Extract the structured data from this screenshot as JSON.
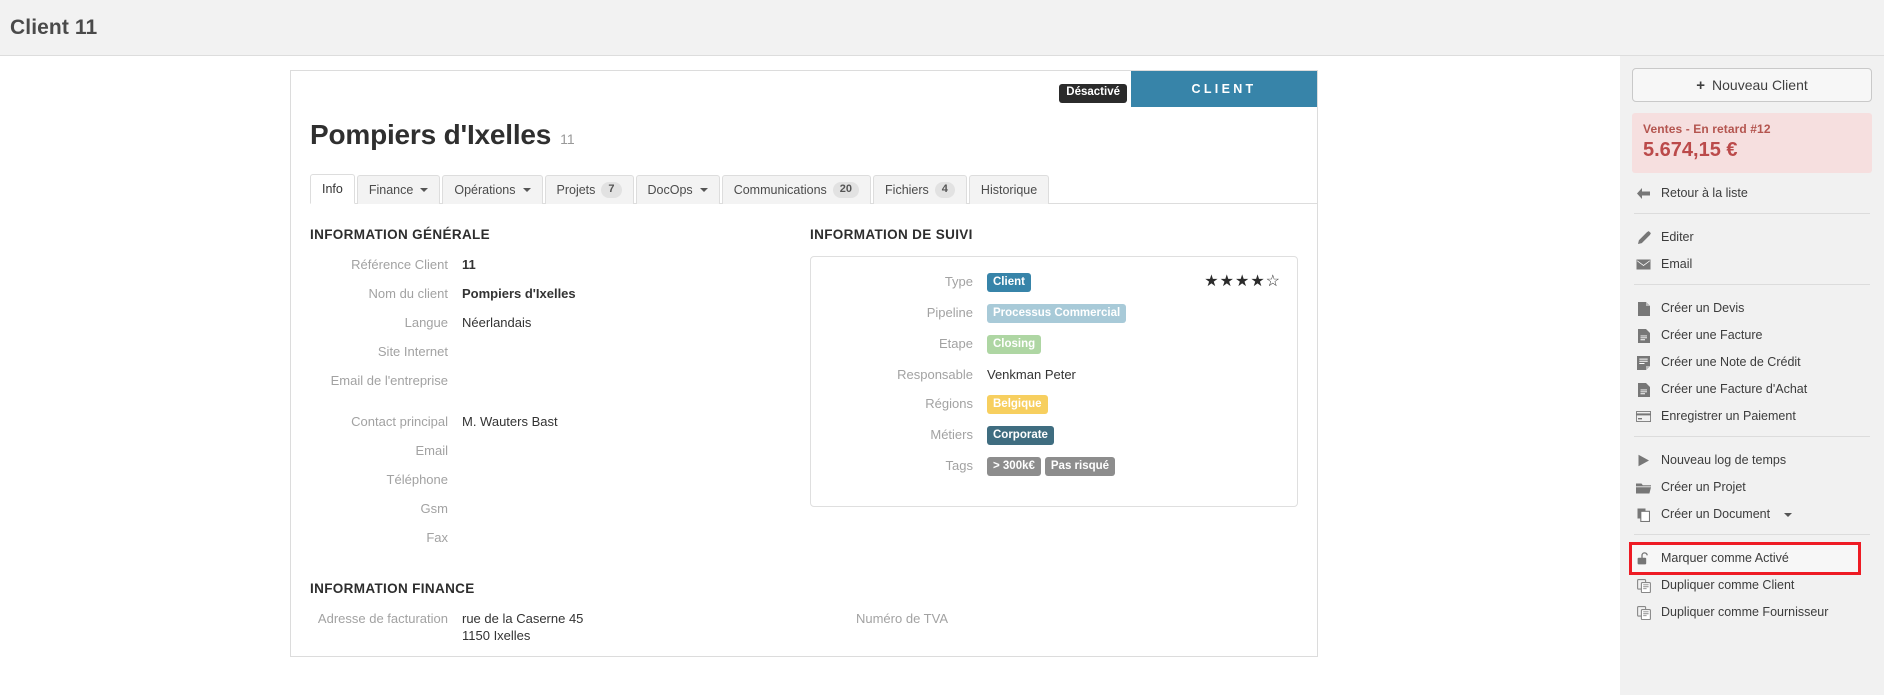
{
  "topbar": {
    "title": "Client 11"
  },
  "card": {
    "status_badge": "Désactivé",
    "type_banner": "CLIENT",
    "title": "Pompiers d'Ixelles",
    "title_sub": "11",
    "tabs": [
      {
        "label": "Info",
        "count": null,
        "caret": false,
        "active": true
      },
      {
        "label": "Finance",
        "count": null,
        "caret": true,
        "active": false
      },
      {
        "label": "Opérations",
        "count": null,
        "caret": true,
        "active": false
      },
      {
        "label": "Projets",
        "count": "7",
        "caret": false,
        "active": false
      },
      {
        "label": "DocOps",
        "count": null,
        "caret": true,
        "active": false
      },
      {
        "label": "Communications",
        "count": "20",
        "caret": false,
        "active": false
      },
      {
        "label": "Fichiers",
        "count": "4",
        "caret": false,
        "active": false
      },
      {
        "label": "Historique",
        "count": null,
        "caret": false,
        "active": false
      }
    ],
    "general": {
      "section_title": "INFORMATION GÉNÉRALE",
      "fields": [
        {
          "label": "Référence Client",
          "value": "11",
          "bold": true
        },
        {
          "label": "Nom du client",
          "value": "Pompiers d'Ixelles",
          "bold": true
        },
        {
          "label": "Langue",
          "value": "Néerlandais",
          "bold": false
        },
        {
          "label": "Site Internet",
          "value": "",
          "bold": false
        },
        {
          "label": "Email de l'entreprise",
          "value": "",
          "bold": false
        },
        {
          "label": "Contact principal",
          "value": "M. Wauters Bast",
          "bold": false
        },
        {
          "label": "Email",
          "value": "",
          "bold": false
        },
        {
          "label": "Téléphone",
          "value": "",
          "bold": false
        },
        {
          "label": "Gsm",
          "value": "",
          "bold": false
        },
        {
          "label": "Fax",
          "value": "",
          "bold": false
        }
      ]
    },
    "suivi": {
      "section_title": "INFORMATION DE SUIVI",
      "rating_filled": 4,
      "rating_total": 5,
      "fields": [
        {
          "label": "Type",
          "pills": [
            {
              "text": "Client",
              "style": "pill-client"
            }
          ]
        },
        {
          "label": "Pipeline",
          "pills": [
            {
              "text": "Processus Commercial",
              "style": "pill-pipeline"
            }
          ]
        },
        {
          "label": "Etape",
          "pills": [
            {
              "text": "Closing",
              "style": "pill-etape"
            }
          ]
        },
        {
          "label": "Responsable",
          "text": "Venkman Peter"
        },
        {
          "label": "Régions",
          "pills": [
            {
              "text": "Belgique",
              "style": "pill-region"
            }
          ]
        },
        {
          "label": "Métiers",
          "pills": [
            {
              "text": "Corporate",
              "style": "pill-metier"
            }
          ]
        },
        {
          "label": "Tags",
          "pills": [
            {
              "text": "> 300k€",
              "style": "pill-tag"
            },
            {
              "text": "Pas risqué",
              "style": "pill-tag"
            }
          ]
        }
      ]
    },
    "finance": {
      "section_title": "INFORMATION FINANCE",
      "address_label": "Adresse de facturation",
      "address_line1": "rue de la Caserne 45",
      "address_line2": "1150 Ixelles",
      "vat_label": "Numéro de TVA",
      "vat_value": ""
    }
  },
  "sidebar": {
    "new_client_button": "Nouveau Client",
    "alert": {
      "label": "Ventes - En retard  #12",
      "amount": "5.674,15 €"
    },
    "groups": [
      {
        "items": [
          {
            "label": "Retour à la liste",
            "icon": "arrow-left-icon",
            "highlighted": false,
            "caret": false
          }
        ]
      },
      {
        "items": [
          {
            "label": "Editer",
            "icon": "pencil-icon",
            "highlighted": false,
            "caret": false
          },
          {
            "label": "Email",
            "icon": "envelope-icon",
            "highlighted": false,
            "caret": false
          }
        ]
      },
      {
        "items": [
          {
            "label": "Créer un Devis",
            "icon": "document-icon",
            "highlighted": false,
            "caret": false
          },
          {
            "label": "Créer une Facture",
            "icon": "invoice-icon",
            "highlighted": false,
            "caret": false
          },
          {
            "label": "Créer une Note de Crédit",
            "icon": "credit-note-icon",
            "highlighted": false,
            "caret": false
          },
          {
            "label": "Créer une Facture d'Achat",
            "icon": "invoice-icon",
            "highlighted": false,
            "caret": false
          },
          {
            "label": "Enregistrer un Paiement",
            "icon": "credit-card-icon",
            "highlighted": false,
            "caret": false
          }
        ]
      },
      {
        "items": [
          {
            "label": "Nouveau log de temps",
            "icon": "play-icon",
            "highlighted": false,
            "caret": false
          },
          {
            "label": "Créer un Projet",
            "icon": "folder-icon",
            "highlighted": false,
            "caret": false
          },
          {
            "label": "Créer un Document",
            "icon": "copy-icon",
            "highlighted": false,
            "caret": true
          }
        ]
      },
      {
        "items": [
          {
            "label": "Marquer comme Activé",
            "icon": "unlock-icon",
            "highlighted": true,
            "caret": false
          },
          {
            "label": "Dupliquer comme Client",
            "icon": "duplicate-icon",
            "highlighted": false,
            "caret": false
          },
          {
            "label": "Dupliquer comme Fournisseur",
            "icon": "duplicate-icon",
            "highlighted": false,
            "caret": false
          }
        ]
      }
    ]
  },
  "colors": {
    "accent_blue": "#3784a9",
    "alert_red": "#bb4a4a",
    "highlight_red": "#ee1b24"
  }
}
